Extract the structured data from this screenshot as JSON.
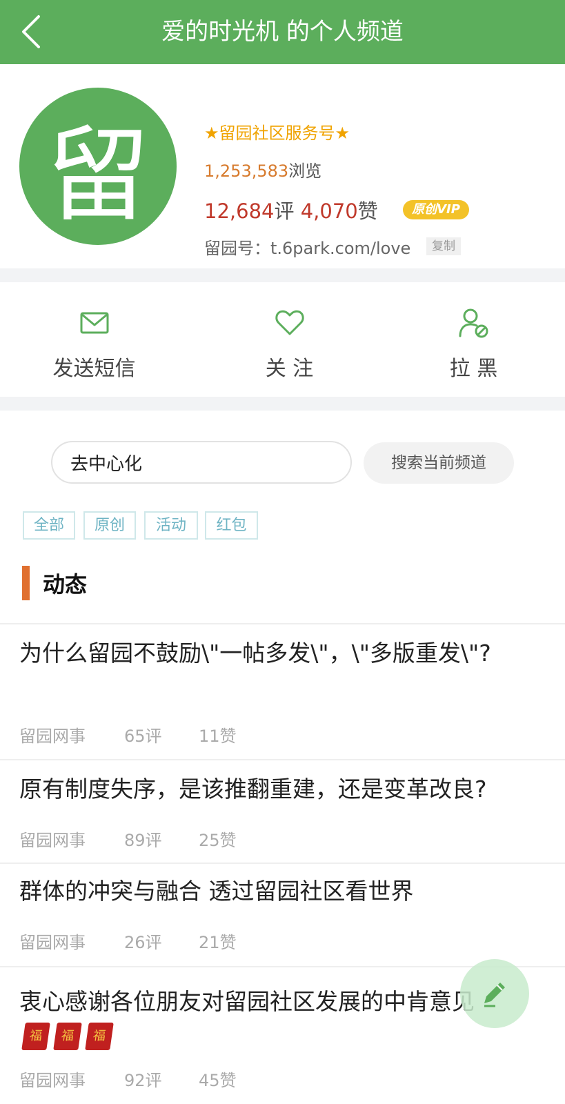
{
  "header": {
    "title": "爱的时光机 的个人频道"
  },
  "profile": {
    "avatar_glyph": "留",
    "service_label": "★留园社区服务号★",
    "views_count": "1,253,583",
    "views_unit": "浏览",
    "comments_count": "12,684",
    "comments_unit": "评",
    "likes_count": "4,070",
    "likes_unit": "赞",
    "vip_badge": "原创VIP",
    "channel_id_label": "留园号：",
    "channel_id": "t.6park.com/love",
    "copy_label": "复制"
  },
  "actions": [
    {
      "label": "发送短信",
      "icon": "mail-icon"
    },
    {
      "label": "关 注",
      "icon": "heart-icon"
    },
    {
      "label": "拉 黑",
      "icon": "block-user-icon"
    }
  ],
  "search": {
    "value": "去中心化",
    "button_label": "搜索当前频道"
  },
  "filters": [
    "全部",
    "原创",
    "活动",
    "红包"
  ],
  "section": {
    "title": "动态"
  },
  "posts": [
    {
      "title": "为什么留园不鼓励\\\"一帖多发\\\"，\\\"多版重发\\\"?",
      "source": "留园网事",
      "comments": "65评",
      "likes": "11赞"
    },
    {
      "title": "原有制度失序，是该推翻重建，还是变革改良?",
      "source": "留园网事",
      "comments": "89评",
      "likes": "25赞"
    },
    {
      "title": "群体的冲突与融合 透过留园社区看世界",
      "source": "留园网事",
      "comments": "26评",
      "likes": "21赞"
    },
    {
      "title": "衷心感谢各位朋友对留园社区发展的中肯意见",
      "red_packet_glyph": "福",
      "source": "留园网事",
      "comments": "92评",
      "likes": "45赞"
    }
  ],
  "colors": {
    "brand_green": "#5cae5c",
    "accent_orange": "#e07030",
    "stat_red": "#c0392b",
    "service_gold": "#f0a300"
  }
}
